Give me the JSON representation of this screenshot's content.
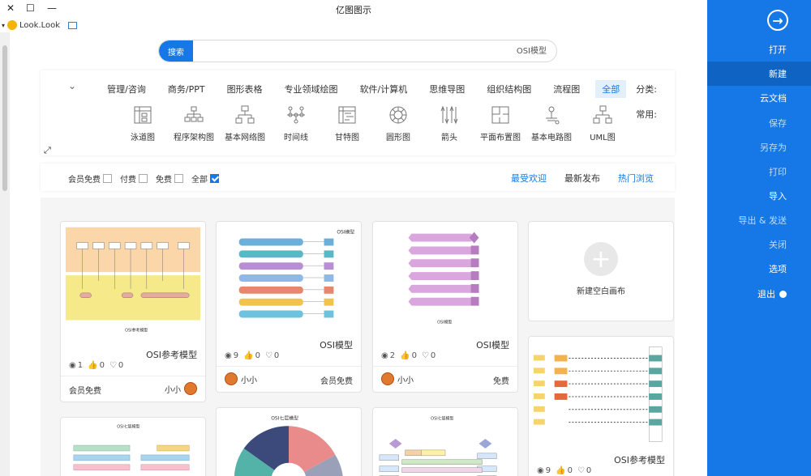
{
  "window": {
    "title": "亿图图示",
    "controls": [
      "✕",
      "☐",
      "—"
    ],
    "lookbar_label": "Look.Look"
  },
  "nav": {
    "items": [
      {
        "label": "打开",
        "state": "normal"
      },
      {
        "label": "新建",
        "state": "active"
      },
      {
        "label": "云文档",
        "state": "normal"
      },
      {
        "label": "保存",
        "state": "dim"
      },
      {
        "label": "另存为",
        "state": "dim"
      },
      {
        "label": "打印",
        "state": "dim"
      },
      {
        "label": "导入",
        "state": "normal"
      },
      {
        "label": "导出 & 发送",
        "state": "dim"
      },
      {
        "label": "关闭",
        "state": "dim"
      },
      {
        "label": "选项",
        "state": "normal"
      },
      {
        "label": "退出",
        "state": "normal"
      }
    ]
  },
  "search": {
    "button_label": "搜索",
    "value": "OSI模型"
  },
  "categories": {
    "label": "分类:",
    "items": [
      "全部",
      "流程图",
      "组织结构图",
      "思维导图",
      "软件/计算机",
      "专业领域绘图",
      "图形表格",
      "商务/PPT",
      "管理/咨询"
    ],
    "active": "全部"
  },
  "common": {
    "label": "常用:",
    "items": [
      "UML图",
      "基本电路图",
      "平面布置图",
      "箭头",
      "圆形图",
      "甘特图",
      "时间线",
      "基本网络图",
      "程序架构图",
      "泳道图"
    ]
  },
  "sort": {
    "tabs": [
      "热门浏览",
      "最新发布",
      "最受欢迎"
    ],
    "active": "热门浏览"
  },
  "filters": [
    {
      "label": "全部",
      "checked": true
    },
    {
      "label": "免费",
      "checked": false
    },
    {
      "label": "付费",
      "checked": false
    },
    {
      "label": "会员免费",
      "checked": false
    }
  ],
  "blank_card": {
    "label": "新建空白画布"
  },
  "templates": [
    {
      "title": "OSI模型",
      "views": "2",
      "likes": "0",
      "comments": "0",
      "author": "小小",
      "price": "免费"
    },
    {
      "title": "OSI模型",
      "views": "9",
      "likes": "0",
      "comments": "0",
      "author": "小小",
      "price": "会员免费"
    },
    {
      "title": "OSI参考模型",
      "views": "1",
      "likes": "0",
      "comments": "0",
      "author": "小小",
      "price": "会员免费"
    },
    {
      "title": "OSI参考模型",
      "views": "9",
      "likes": "0",
      "comments": "0",
      "author": "",
      "price": ""
    },
    {
      "title": "OSI七层模型",
      "views": "",
      "likes": "",
      "comments": "",
      "author": "",
      "price": ""
    },
    {
      "title": "OSI七层模型",
      "views": "",
      "likes": "",
      "comments": "",
      "author": "",
      "price": ""
    },
    {
      "title": "OSI七层模型",
      "views": "",
      "likes": "",
      "comments": "",
      "author": "",
      "price": ""
    }
  ],
  "colors": {
    "brand": "#1578e6",
    "nav_active": "#0f63c2"
  }
}
